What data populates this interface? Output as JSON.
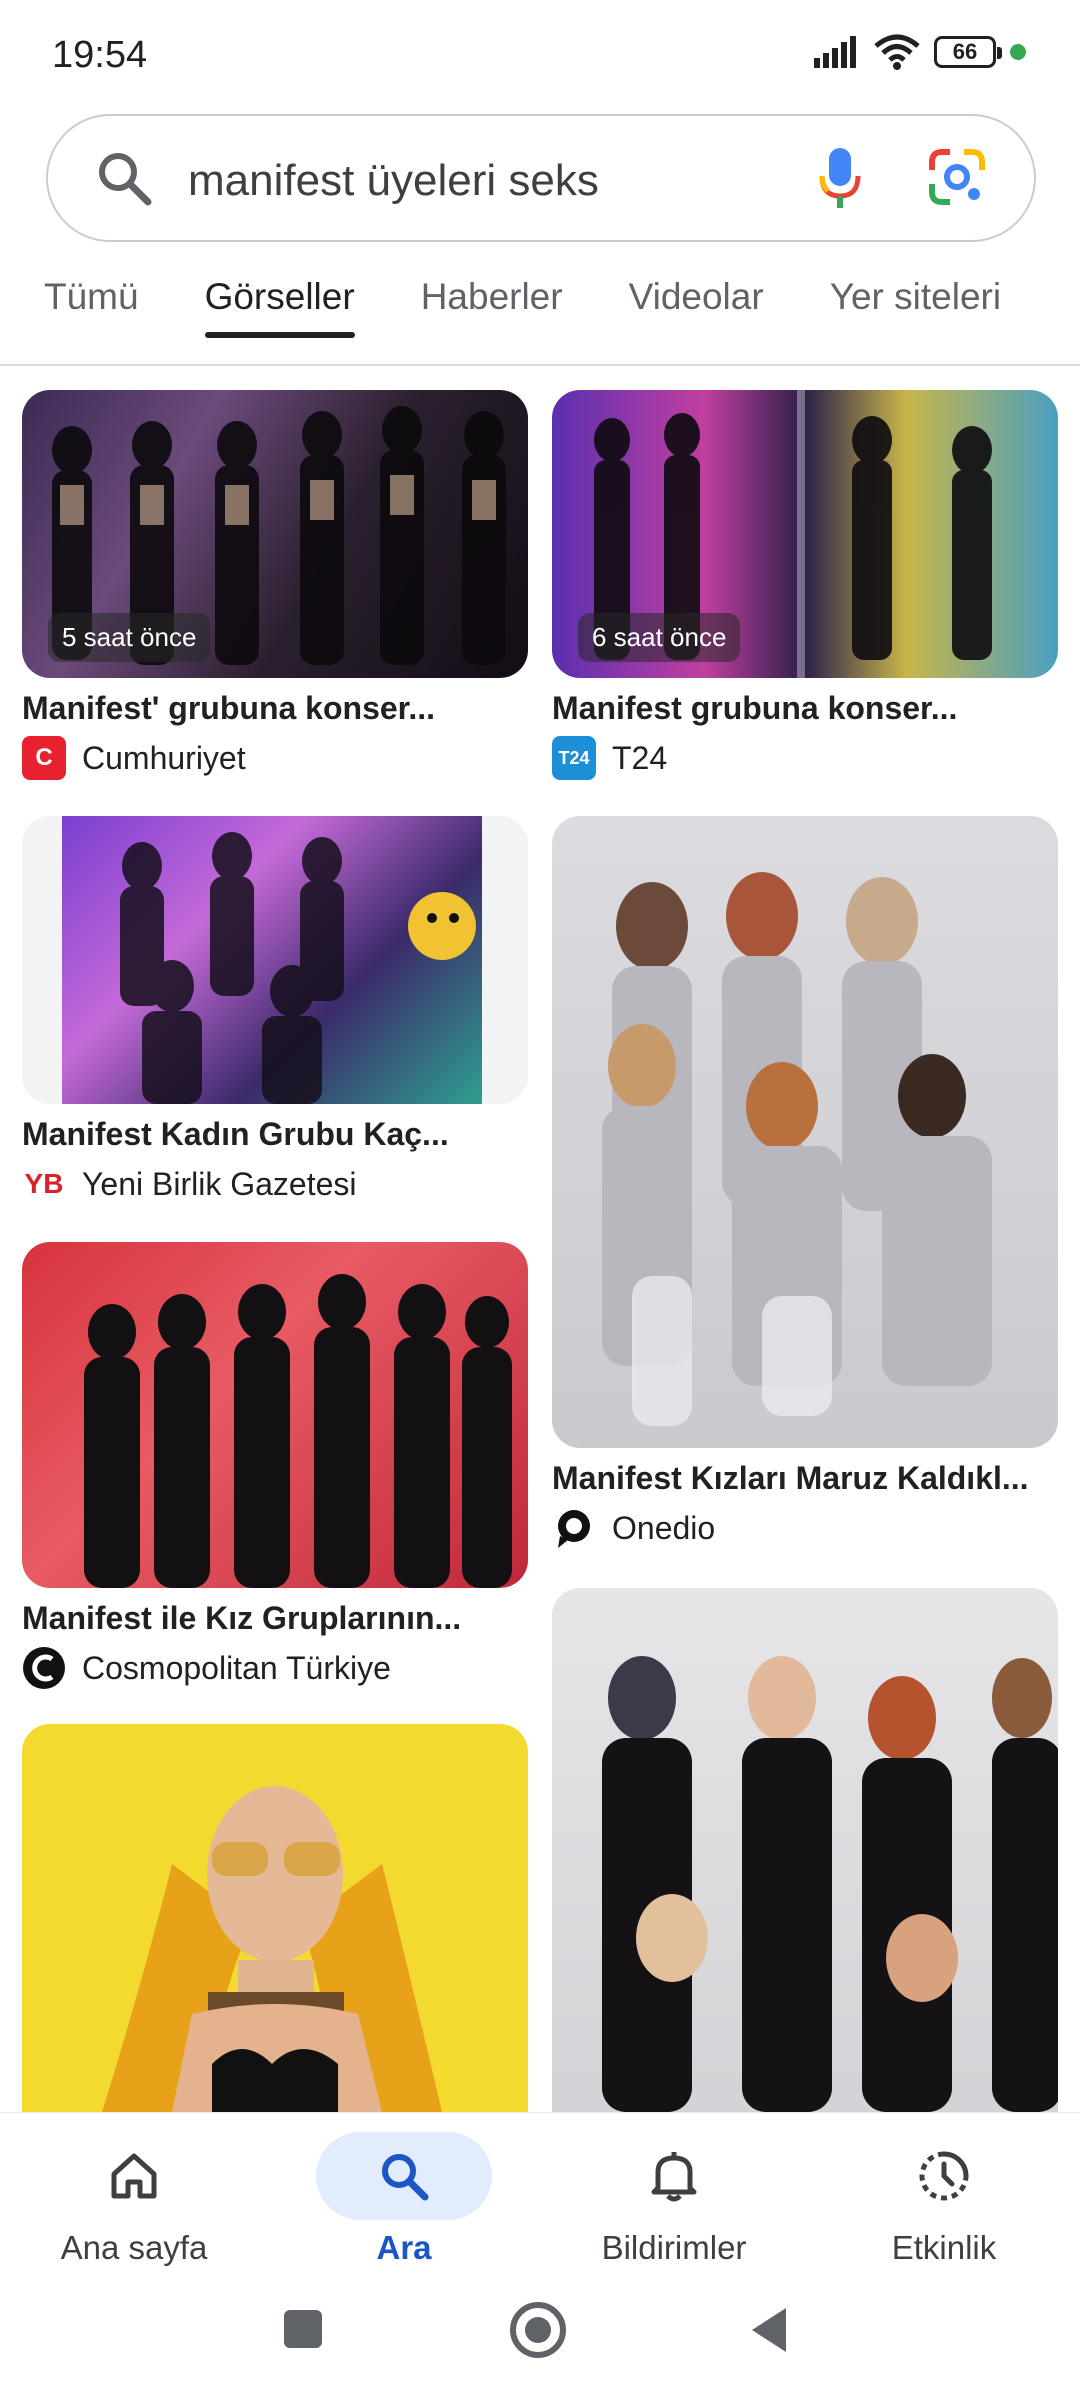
{
  "status": {
    "time": "19:54",
    "battery": "66"
  },
  "search": {
    "query": "manifest üyeleri seks"
  },
  "tabs": [
    "Tümü",
    "Görseller",
    "Haberler",
    "Videolar",
    "Yer siteleri"
  ],
  "results": [
    {
      "title": "Manifest' grubuna konser...",
      "source": "Cumhuriyet",
      "badge": "5 saat önce"
    },
    {
      "title": "Manifest grubuna konser...",
      "source": "T24",
      "badge": "6 saat önce"
    },
    {
      "title": "Manifest Kadın Grubu Kaç...",
      "source": "Yeni Birlik Gazetesi"
    },
    {
      "title": "Manifest Kızları Maruz Kaldıkl...",
      "source": "Onedio"
    },
    {
      "title": "Manifest ile Kız Gruplarının...",
      "source": "Cosmopolitan Türkiye"
    }
  ],
  "favicons": {
    "cumhuriyet": "C",
    "t24": "T24",
    "yeni_birlik": "YB"
  },
  "nav": [
    "Ana sayfa",
    "Ara",
    "Bildirimler",
    "Etkinlik"
  ],
  "colors": {
    "accent": "#1a56c4",
    "active_pill": "#e2ecfd",
    "cumhuriyet": "#e8212e",
    "t24": "#1c8fd6",
    "yb": "#d8222a"
  }
}
